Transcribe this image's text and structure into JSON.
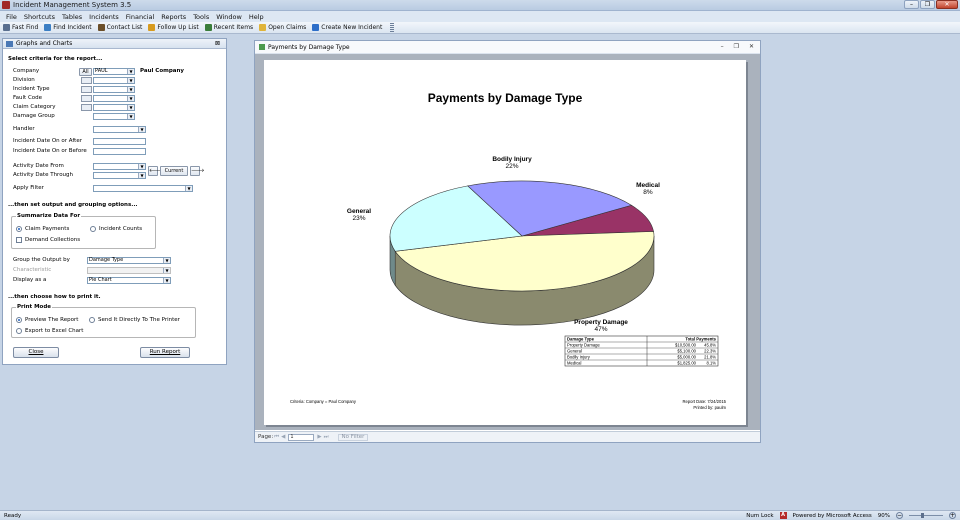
{
  "app": {
    "title": "Incident Management System 3.5"
  },
  "menu": [
    "File",
    "Shortcuts",
    "Tables",
    "Incidents",
    "Financial",
    "Reports",
    "Tools",
    "Window",
    "Help"
  ],
  "toolbar": [
    {
      "label": "Fast Find",
      "icon": "binoculars-icon",
      "color": "#5a6f8f"
    },
    {
      "label": "Find Incident",
      "icon": "magnifier-icon",
      "color": "#3c7fc4"
    },
    {
      "label": "Contact List",
      "icon": "phone-icon",
      "color": "#6b4f2a"
    },
    {
      "label": "Follow Up List",
      "icon": "pencil-icon",
      "color": "#d79b1f"
    },
    {
      "label": "Recent Items",
      "icon": "clock-icon",
      "color": "#3a7d3a"
    },
    {
      "label": "Open Claims",
      "icon": "folder-icon",
      "color": "#e0b43a"
    },
    {
      "label": "Create New Incident",
      "icon": "arrow-right-icon",
      "color": "#2e6fc9"
    }
  ],
  "form": {
    "title": "Graphs and Charts",
    "select_heading": "Select criteria for the report...",
    "company_label": "Company",
    "company_all": "All",
    "company_code": "PAUL",
    "company_name": "Paul Company",
    "division_label": "Division",
    "incident_type_label": "Incident Type",
    "fault_code_label": "Fault Code",
    "claim_category_label": "Claim Category",
    "damage_group_label": "Damage Group",
    "handler_label": "Handler",
    "date_after_label": "Incident Date On or After",
    "date_before_label": "Incident Date On or Before",
    "activity_from_label": "Activity Date From",
    "activity_through_label": "Activity Date Through",
    "current_button": "Current",
    "apply_filter_label": "Apply Filter",
    "output_heading": "...then set output and grouping options...",
    "summarize_title": "Summarize Data For",
    "claim_payments": "Claim Payments",
    "incident_counts": "Incident Counts",
    "demand_collections": "Demand Collections",
    "group_by_label": "Group the Output by",
    "group_by_value": "Damage Type",
    "characteristic_label": "Characteristic",
    "display_as_label": "Display as a",
    "display_as_value": "Pie Chart",
    "print_heading": "...then choose how to print it.",
    "print_mode_title": "Print Mode",
    "preview_report": "Preview The Report",
    "send_printer": "Send It Directly To The Printer",
    "export_excel": "Export to Excel Chart",
    "close_button": "Close",
    "run_button": "Run Report"
  },
  "report_window": {
    "title": "Payments by Damage Type",
    "criteria": "Criteria: Company = Paul Company",
    "report_date": "Report Date: 7/24/2015",
    "printed_by": "Printed by: paulm",
    "footer": {
      "page_label": "Page:",
      "page_value": "1",
      "no_filter": "No Filter"
    }
  },
  "chart_data": {
    "type": "pie",
    "title": "Payments by Damage Type",
    "slices": [
      {
        "name": "Property Damage",
        "value": 10500.0,
        "amount": "$10,500.00",
        "percent": "45.8%",
        "label_pct": "47%",
        "color": "#ffffcc",
        "side": "#8a8a6e"
      },
      {
        "name": "General",
        "value": 5100.0,
        "amount": "$5,100.00",
        "percent": "22.3%",
        "label_pct": "23%",
        "color": "#ccffff",
        "side": "#6f8a8a"
      },
      {
        "name": "Bodily Injury",
        "value": 5000.0,
        "amount": "$5,000.00",
        "percent": "21.8%",
        "label_pct": "22%",
        "color": "#9999ff",
        "side": "#5e5e9e"
      },
      {
        "name": "Medical",
        "value": 1825.0,
        "amount": "$1,825.00",
        "percent": "8.1%",
        "label_pct": "8%",
        "color": "#993366",
        "side": "#5e1f3f"
      }
    ],
    "table_headers": [
      "Damage Type",
      "Total Payments"
    ]
  },
  "status": {
    "left": "Ready",
    "num_lock": "Num Lock",
    "powered": "Powered by Microsoft Access",
    "zoom": "90%"
  }
}
